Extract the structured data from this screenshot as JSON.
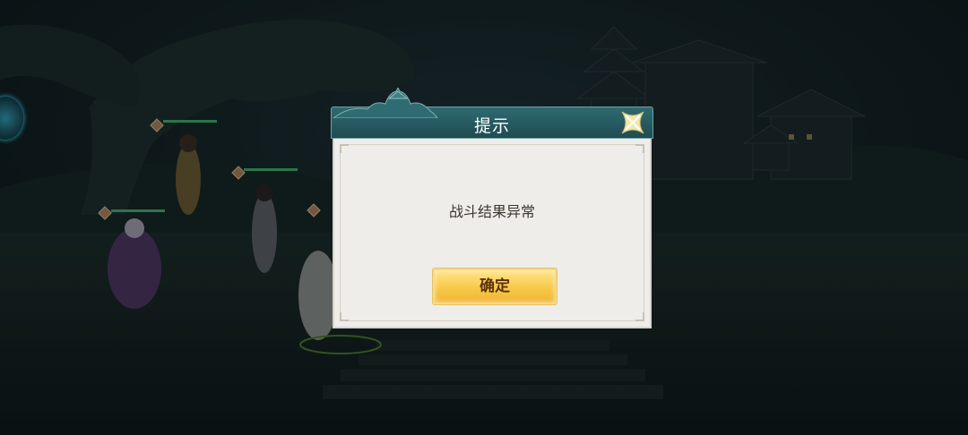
{
  "dialog": {
    "title": "提示",
    "message": "战斗结果异常",
    "confirm_label": "确定"
  },
  "icons": {
    "close": "close-x-icon"
  },
  "colors": {
    "header": "#2e6a70",
    "body": "#eeedea",
    "button": "#f8c94a",
    "button_text": "#5a3209"
  }
}
